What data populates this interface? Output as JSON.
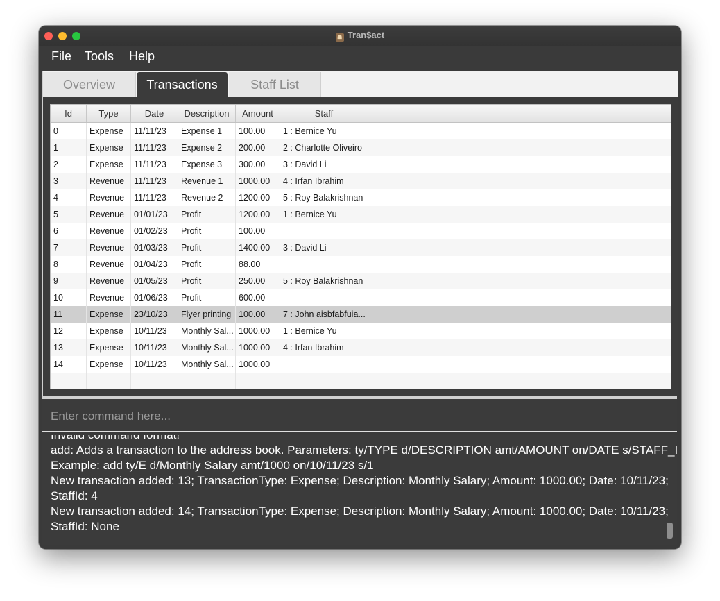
{
  "window": {
    "title": "Tran$act"
  },
  "menu": [
    "File",
    "Tools",
    "Help"
  ],
  "tabs": [
    {
      "label": "Overview",
      "active": false
    },
    {
      "label": "Transactions",
      "active": true
    },
    {
      "label": "Staff List",
      "active": false
    }
  ],
  "table": {
    "columns": [
      "Id",
      "Type",
      "Date",
      "Description",
      "Amount",
      "Staff"
    ],
    "selected_row": 11,
    "rows": [
      [
        "0",
        "Expense",
        "11/11/23",
        "Expense 1",
        "100.00",
        "1 : Bernice Yu"
      ],
      [
        "1",
        "Expense",
        "11/11/23",
        "Expense 2",
        "200.00",
        "2 : Charlotte Oliveiro"
      ],
      [
        "2",
        "Expense",
        "11/11/23",
        "Expense 3",
        "300.00",
        "3 : David Li"
      ],
      [
        "3",
        "Revenue",
        "11/11/23",
        "Revenue 1",
        "1000.00",
        "4 : Irfan Ibrahim"
      ],
      [
        "4",
        "Revenue",
        "11/11/23",
        "Revenue 2",
        "1200.00",
        "5 : Roy Balakrishnan"
      ],
      [
        "5",
        "Revenue",
        "01/01/23",
        "Profit",
        "1200.00",
        "1 : Bernice Yu"
      ],
      [
        "6",
        "Revenue",
        "01/02/23",
        "Profit",
        "100.00",
        ""
      ],
      [
        "7",
        "Revenue",
        "01/03/23",
        "Profit",
        "1400.00",
        "3 : David Li"
      ],
      [
        "8",
        "Revenue",
        "01/04/23",
        "Profit",
        "88.00",
        ""
      ],
      [
        "9",
        "Revenue",
        "01/05/23",
        "Profit",
        "250.00",
        "5 : Roy Balakrishnan"
      ],
      [
        "10",
        "Revenue",
        "01/06/23",
        "Profit",
        "600.00",
        ""
      ],
      [
        "11",
        "Expense",
        "23/10/23",
        "Flyer printing",
        "100.00",
        "7 : John aisbfabfuia..."
      ],
      [
        "12",
        "Expense",
        "10/11/23",
        "Monthly Sal...",
        "1000.00",
        "1 : Bernice Yu"
      ],
      [
        "13",
        "Expense",
        "10/11/23",
        "Monthly Sal...",
        "1000.00",
        "4 : Irfan Ibrahim"
      ],
      [
        "14",
        "Expense",
        "10/11/23",
        "Monthly Sal...",
        "1000.00",
        ""
      ]
    ]
  },
  "command": {
    "placeholder": "Enter command here...",
    "value": ""
  },
  "result": {
    "lines": [
      "Invalid command format!",
      "add: Adds a transaction to the address book. Parameters: ty/TYPE d/DESCRIPTION amt/AMOUNT on/DATE s/STAFF_ID",
      "Example: add ty/E d/Monthly Salary amt/1000 on/10/11/23 s/1",
      "New transaction added: 13; TransactionType: Expense; Description: Monthly Salary; Amount: 1000.00; Date: 10/11/23;",
      "StaffId: 4",
      "New transaction added: 14; TransactionType: Expense; Description: Monthly Salary; Amount: 1000.00; Date: 10/11/23;",
      "StaffId: None"
    ]
  },
  "colors": {
    "panel_dark": "#3b3b3b",
    "selected_row": "#cfcfcf"
  }
}
